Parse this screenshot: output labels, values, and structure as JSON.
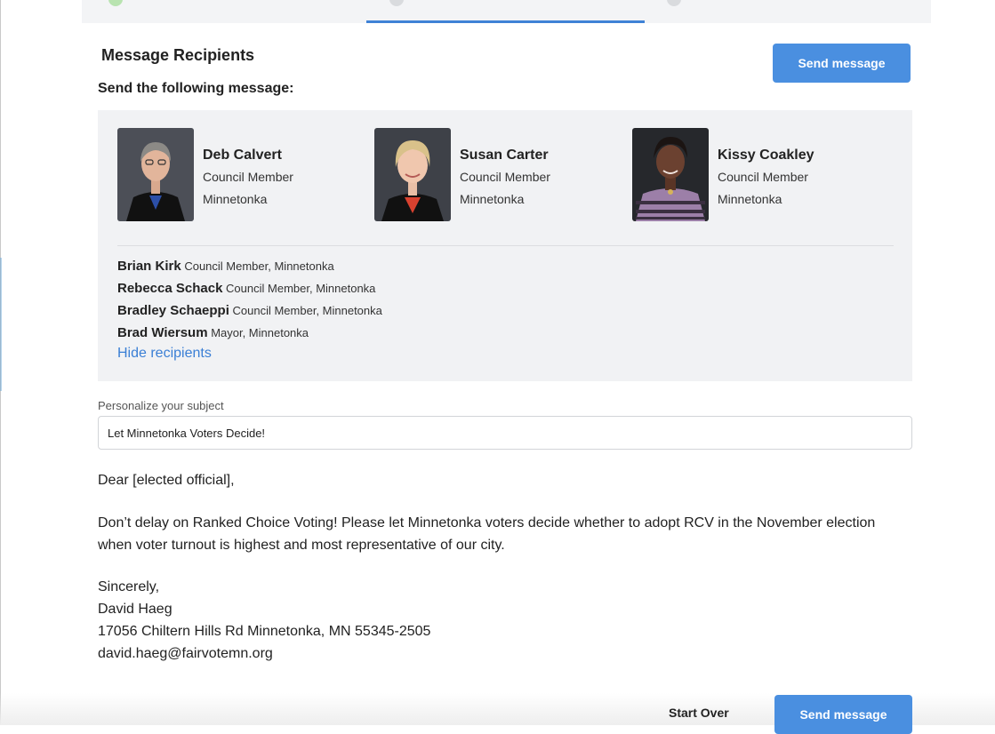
{
  "header": {
    "title": "Message Recipients",
    "send_top_label": "Send message",
    "subtitle": "Send the following message:"
  },
  "featured_recipients": [
    {
      "name": "Deb Calvert",
      "role": "Council Member",
      "city": "Minnetonka"
    },
    {
      "name": "Susan Carter",
      "role": "Council Member",
      "city": "Minnetonka"
    },
    {
      "name": "Kissy Coakley",
      "role": "Council Member",
      "city": "Minnetonka"
    }
  ],
  "other_recipients": [
    {
      "name": "Brian Kirk",
      "detail": "Council Member, Minnetonka"
    },
    {
      "name": "Rebecca Schack",
      "detail": "Council Member, Minnetonka"
    },
    {
      "name": "Bradley Schaeppi",
      "detail": "Council Member, Minnetonka"
    },
    {
      "name": "Brad Wiersum",
      "detail": "Mayor, Minnetonka"
    }
  ],
  "hide_recipients_label": "Hide recipients",
  "subject": {
    "label": "Personalize your subject",
    "value": "Let Minnetonka Voters Decide!"
  },
  "message": {
    "greeting": "Dear [elected official],",
    "body": "Don’t delay on Ranked Choice Voting! Please let Minnetonka voters decide whether to adopt RCV in the November election when voter turnout is highest and most representative of our city.",
    "signoff": "Sincerely,",
    "sender_name": "David Haeg",
    "sender_address": "17056 Chiltern Hills Rd Minnetonka, MN 55345-2505",
    "sender_email": "david.haeg@fairvotemn.org"
  },
  "footer": {
    "start_over_label": "Start Over",
    "send_bottom_label": "Send message"
  },
  "colors": {
    "primary": "#4a8fe0",
    "link": "#3a7fd5",
    "panel_bg": "#f1f2f4"
  }
}
